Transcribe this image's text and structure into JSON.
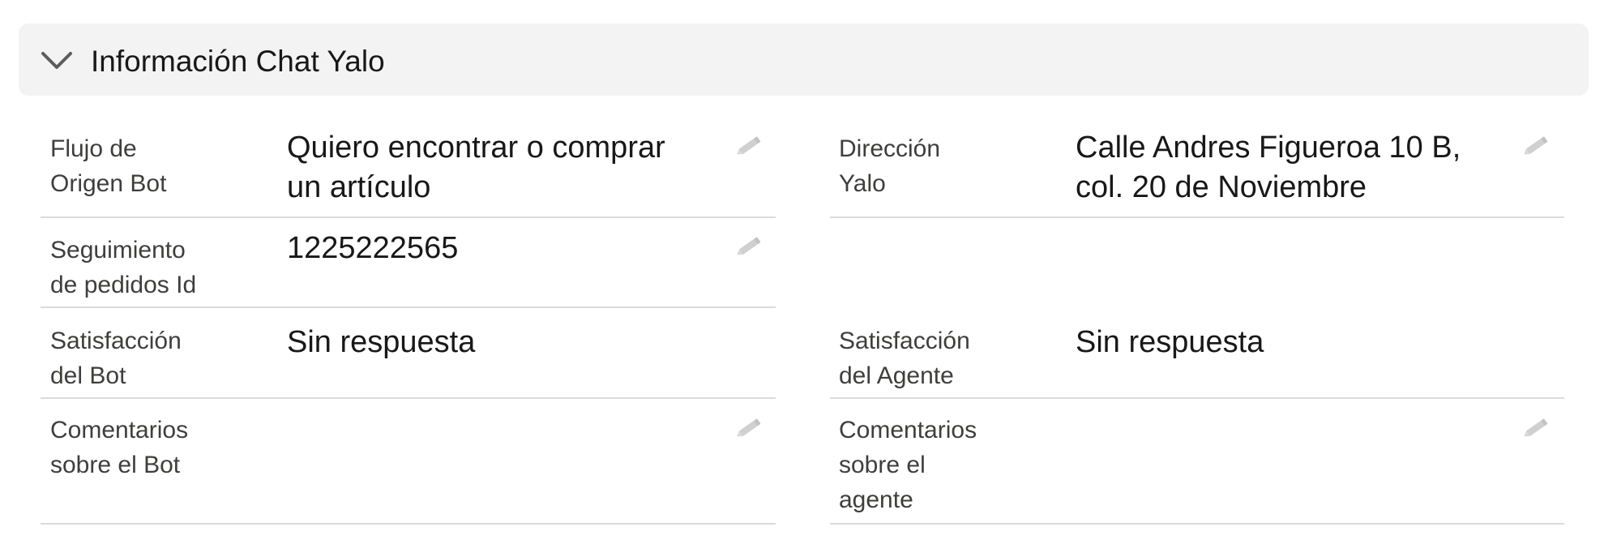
{
  "section": {
    "title": "Información Chat Yalo",
    "toggle_icon": "chevron-down-icon"
  },
  "fields": {
    "flujo_origen_bot": {
      "label_line1": "Flujo de",
      "label_line2": "Origen Bot",
      "value_line1": "Quiero encontrar o comprar",
      "value_line2": "un artículo"
    },
    "direccion_yalo": {
      "label_line1": "Dirección",
      "label_line2": "Yalo",
      "value_line1": "Calle Andres Figueroa 10 B,",
      "value_line2": "col. 20 de Noviembre"
    },
    "seguimiento_pedidos_id": {
      "label_line1": "Seguimiento",
      "label_line2": "de pedidos Id",
      "value": "1225222565"
    },
    "satisfaccion_bot": {
      "label_line1": "Satisfacción",
      "label_line2": "del Bot",
      "value": "Sin respuesta"
    },
    "satisfaccion_agente": {
      "label_line1": "Satisfacción",
      "label_line2": "del Agente",
      "value": "Sin respuesta"
    },
    "comentarios_bot": {
      "label_line1": "Comentarios",
      "label_line2": "sobre el Bot",
      "value": ""
    },
    "comentarios_agente": {
      "label_line1": "Comentarios",
      "label_line2": "sobre el",
      "label_line3": "agente",
      "value": ""
    }
  },
  "icons": {
    "edit": "pencil-icon"
  },
  "colors": {
    "header_background": "#f3f3f3",
    "divider": "#dddbda",
    "label_text": "#3e3e3c",
    "value_text": "#181818",
    "edit_icon": "#c9c9c9"
  }
}
